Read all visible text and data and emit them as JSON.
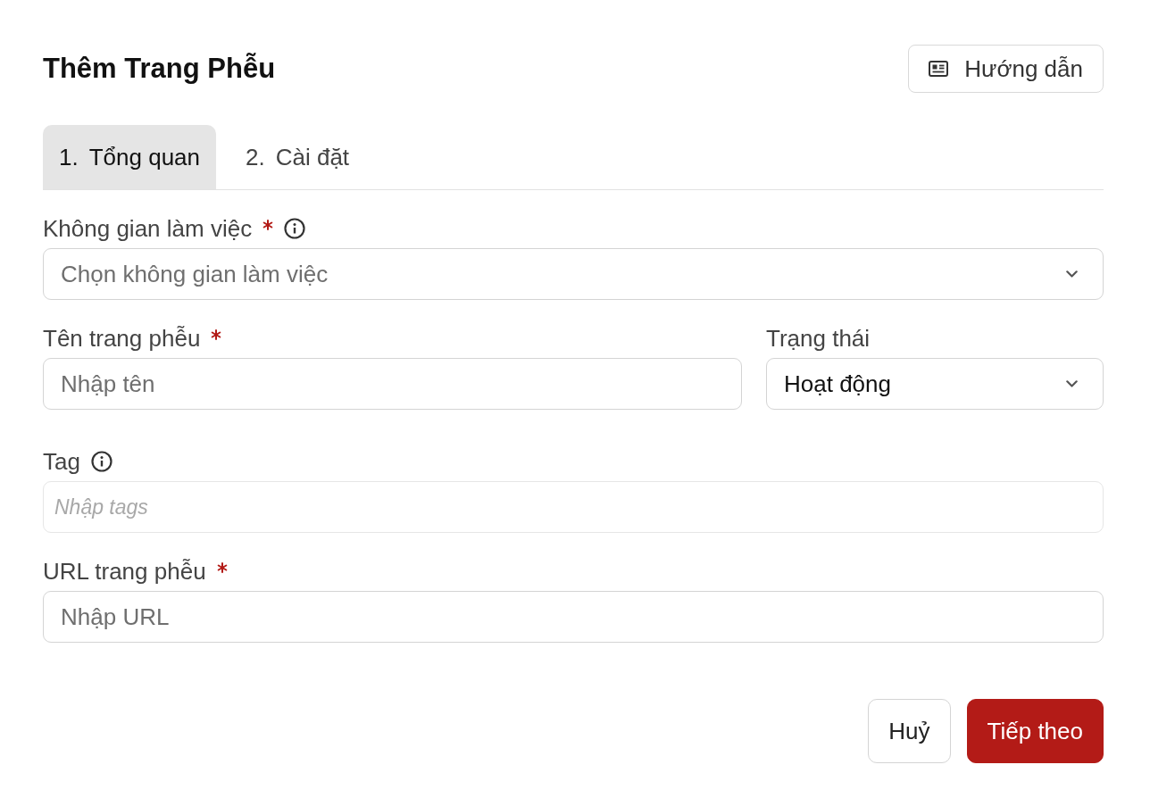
{
  "header": {
    "title": "Thêm Trang Phễu",
    "help_button": {
      "label": "Hướng dẫn"
    }
  },
  "tabs": [
    {
      "number": "1.",
      "label": "Tổng quan",
      "selected": true
    },
    {
      "number": "2.",
      "label": "Cài đặt",
      "selected": false
    }
  ],
  "rows": [
    {
      "fields": [
        {
          "kind": "select",
          "label": "Không gian làm việc",
          "required": true,
          "info": true,
          "placeholder": "Chọn không gian làm việc"
        }
      ]
    },
    {
      "fields": [
        {
          "kind": "text",
          "label": "Tên trang phễu",
          "required": true,
          "info": false,
          "placeholder": "Nhập tên"
        },
        {
          "kind": "select",
          "label": "Trạng thái",
          "required": false,
          "info": false,
          "value": "Hoạt động"
        }
      ]
    },
    {
      "fields": [
        {
          "kind": "tags",
          "label": "Tag",
          "required": false,
          "info": true,
          "placeholder": "Nhập tags"
        }
      ]
    },
    {
      "fields": [
        {
          "kind": "text",
          "label": "URL trang phễu",
          "required": true,
          "info": false,
          "placeholder": "Nhập URL"
        }
      ]
    }
  ],
  "actions": [
    {
      "kind": "secondary",
      "label": "Huỷ"
    },
    {
      "kind": "primary",
      "label": "Tiếp theo"
    }
  ]
}
